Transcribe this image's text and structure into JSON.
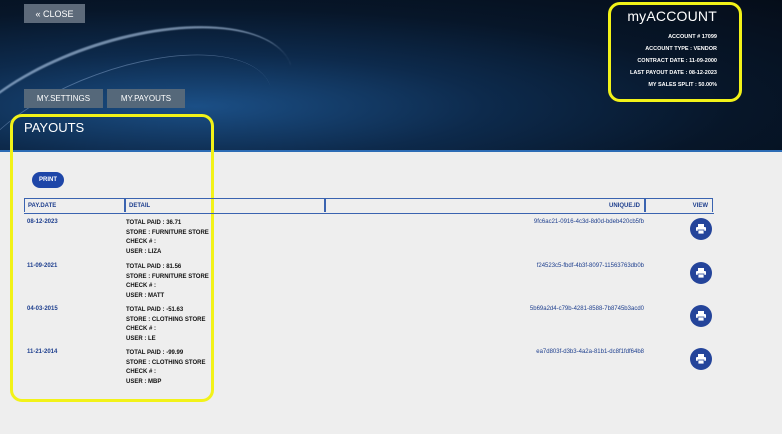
{
  "close_label": "« CLOSE",
  "account": {
    "title": "myACCOUNT",
    "rows": [
      "ACCOUNT # 17099",
      "ACCOUNT TYPE :   VENDOR",
      "CONTRACT DATE :   11-09-2000",
      "LAST PAYOUT DATE :   08-12-2023",
      "MY SALES SPLIT :   50.00%"
    ]
  },
  "tabs": {
    "settings": "MY.SETTINGS",
    "payouts": "MY.PAYOUTS"
  },
  "page_title": "PAYOUTS",
  "print_label": "PRINT",
  "table": {
    "headers": {
      "date": "PAY.DATE",
      "detail": "DETAIL",
      "uid": "UNIQUE.ID",
      "view": "VIEW"
    },
    "rows": [
      {
        "date": "08-12-2023",
        "total": "TOTAL PAID : 36.71",
        "store": "STORE : FURNITURE STORE",
        "check": "CHECK # :",
        "user": "USER : LIZA",
        "uid": "9fc6ac21-0916-4c3d-8d0d-bdeb420cb5fb"
      },
      {
        "date": "11-09-2021",
        "total": "TOTAL PAID : 81.56",
        "store": "STORE : FURNITURE STORE",
        "check": "CHECK # :",
        "user": "USER : MATT",
        "uid": "f24523c5-fbdf-4b3f-8097-11563763db0b"
      },
      {
        "date": "04-03-2015",
        "total": "TOTAL PAID : -51.63",
        "store": "STORE : CLOTHING STORE",
        "check": "CHECK # :",
        "user": "USER : LE",
        "uid": "5b69a2d4-c79b-4281-8588-7b8745b3acd0"
      },
      {
        "date": "11-21-2014",
        "total": "TOTAL PAID : -99.99",
        "store": "STORE : CLOTHING STORE",
        "check": "CHECK # :",
        "user": "USER : MBP",
        "uid": "ea7d803f-d3b3-4a2a-81b1-dc8f1fdf64b8"
      }
    ]
  },
  "colors": {
    "accent": "#1e46a8",
    "highlight": "#f2f218",
    "header_bg": "#0a1c33"
  },
  "icons": {
    "view": "printer-icon"
  }
}
